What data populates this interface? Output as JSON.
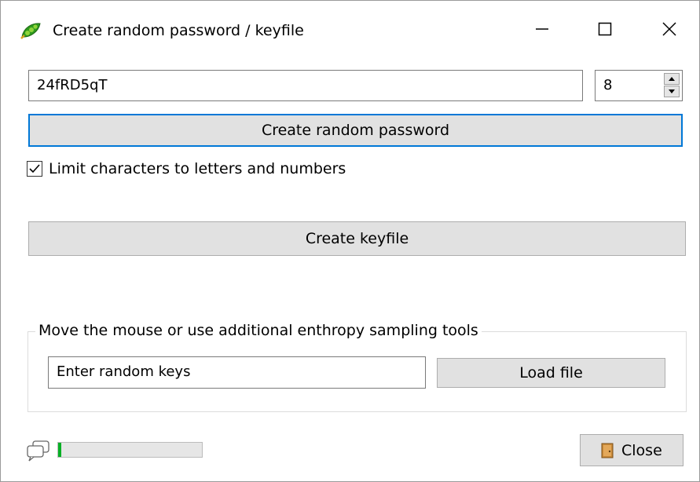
{
  "window": {
    "title": "Create random password / keyfile"
  },
  "password": {
    "value": "24fRD5qT",
    "length": "8"
  },
  "buttons": {
    "create_password": "Create random password",
    "create_keyfile": "Create keyfile",
    "load_file": "Load file",
    "close": "Close"
  },
  "options": {
    "limit_chars_label": "Limit characters to letters and numbers",
    "limit_chars_checked": true
  },
  "entropy": {
    "group_label": "Move the mouse or use additional enthropy sampling tools",
    "keys_value": "Enter random keys"
  },
  "progress": {
    "fraction": 0.02,
    "color": "#06b025"
  },
  "colors": {
    "accent": "#0078d7",
    "button_bg": "#e1e1e1"
  },
  "icons": {
    "app": "pea-pod-icon",
    "minimize": "minimize-icon",
    "maximize": "maximize-icon",
    "close": "close-icon",
    "checkbox": "checkmark-icon",
    "chat": "speech-bubble-icon",
    "door": "door-icon"
  }
}
